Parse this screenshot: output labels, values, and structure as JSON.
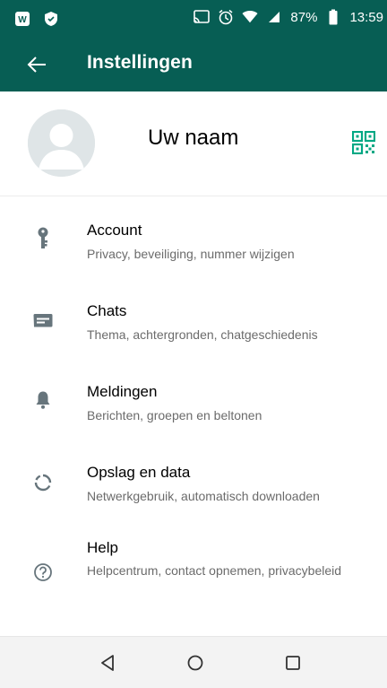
{
  "status_bar": {
    "battery": "87%",
    "time": "13:59"
  },
  "app_bar": {
    "title": "Instellingen"
  },
  "profile": {
    "name": "Uw naam"
  },
  "settings": [
    {
      "label": "Account",
      "sub": "Privacy, beveiliging, nummer wijzigen",
      "icon": "key-icon"
    },
    {
      "label": "Chats",
      "sub": "Thema, achtergronden, chatgeschiedenis",
      "icon": "chat-icon"
    },
    {
      "label": "Meldingen",
      "sub": "Berichten, groepen en beltonen",
      "icon": "bell-icon"
    },
    {
      "label": "Opslag en data",
      "sub": "Netwerkgebruik, automatisch downloaden",
      "icon": "storage-icon"
    },
    {
      "label": "Help",
      "sub": "Helpcentrum, contact opnemen, privacybeleid",
      "icon": "help-icon"
    }
  ],
  "colors": {
    "header": "#075e54",
    "accent_icon": "#00a884",
    "icon_gray": "#67757c",
    "subtitle": "#6b6b6b"
  }
}
